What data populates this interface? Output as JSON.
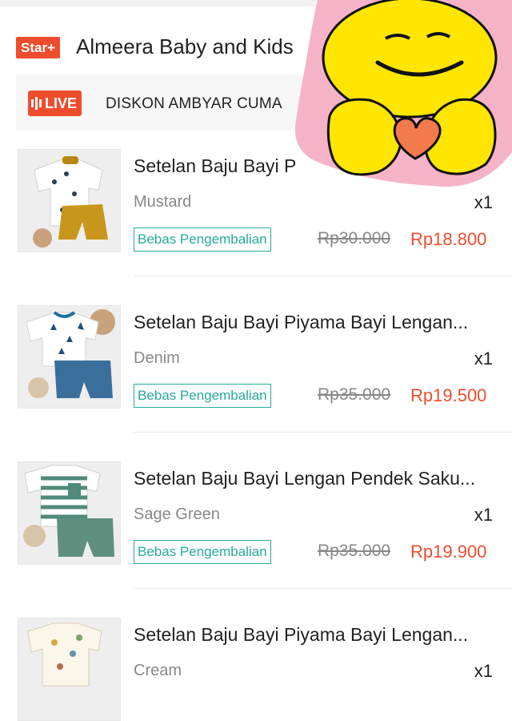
{
  "shop": {
    "badge": "Star+",
    "name": "Almeera Baby and Kids"
  },
  "live": {
    "badge_label": "LIVE",
    "text": "DISKON AMBYAR CUMA"
  },
  "items": [
    {
      "title": "Setelan Baju Bayi P",
      "variant": "Mustard",
      "qty": "x1",
      "tag": "Bebas Pengembalian",
      "old_price": "Rp30.000",
      "new_price": "Rp18.800"
    },
    {
      "title": "Setelan Baju Bayi Piyama Bayi Lengan...",
      "variant": "Denim",
      "qty": "x1",
      "tag": "Bebas Pengembalian",
      "old_price": "Rp35.000",
      "new_price": "Rp19.500"
    },
    {
      "title": "Setelan Baju Bayi Lengan Pendek Saku...",
      "variant": "Sage Green",
      "qty": "x1",
      "tag": "Bebas Pengembalian",
      "old_price": "Rp35.000",
      "new_price": "Rp19.900"
    },
    {
      "title": "Setelan Baju Bayi Piyama Bayi Lengan...",
      "variant": "Cream",
      "qty": "x1"
    }
  ],
  "colors": {
    "brand": "#ee4d2d",
    "tag": "#26aa99"
  }
}
